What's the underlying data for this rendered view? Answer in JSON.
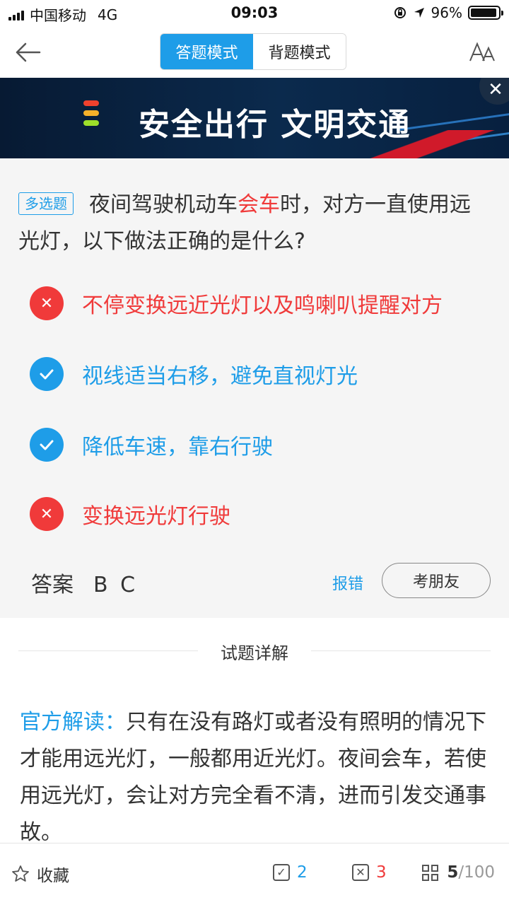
{
  "status": {
    "carrier": "中国移动",
    "network": "4G",
    "time": "09:03",
    "battery": "96%",
    "battery_level": 0.96
  },
  "nav": {
    "mode_answer": "答题模式",
    "mode_review": "背题模式",
    "active_mode": "答题模式"
  },
  "banner": {
    "text": "安全出行 文明交通",
    "close": "✕"
  },
  "question": {
    "tag": "多选题",
    "text_before": "夜间驾驶机动车",
    "text_highlight": "会车",
    "text_after": "时，对方一直使用远光灯，以下做法正确的是什么?",
    "options": [
      {
        "text": "不停变换远近光灯以及鸣喇叭提醒对方",
        "state": "wrong"
      },
      {
        "text": "视线适当右移，避免直视灯光",
        "state": "correct"
      },
      {
        "text": "降低车速，靠右行驶",
        "state": "correct"
      },
      {
        "text": "变换远光灯行驶",
        "state": "wrong"
      }
    ],
    "answer_label": "答案",
    "answer_value": "B C",
    "report": "报错",
    "ask_friend": "考朋友"
  },
  "explanation": {
    "title": "试题详解",
    "label": "官方解读：",
    "body": "只有在没有路灯或者没有照明的情况下才能用远光灯，一般都用近光灯。夜间会车，若使用远光灯，会让对方完全看不清，进而引发交通事故。"
  },
  "bottom": {
    "favorite": "收藏",
    "correct_count": "2",
    "wrong_count": "3",
    "current": "5",
    "total": "/100"
  },
  "colors": {
    "accent": "#1e9de8",
    "error": "#f03a3a"
  }
}
